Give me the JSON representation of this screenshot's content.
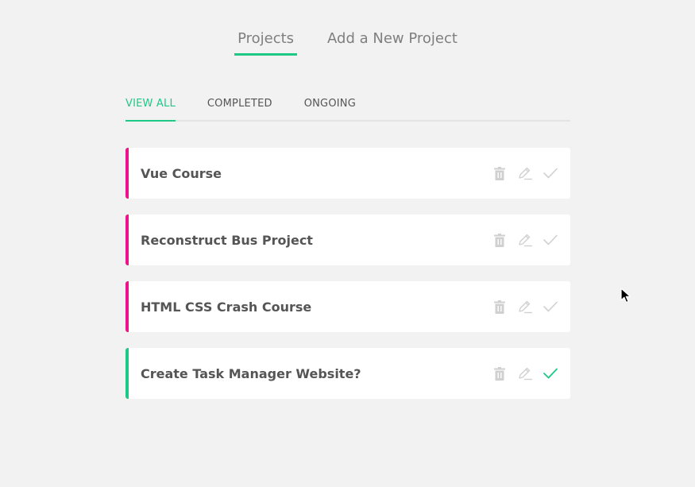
{
  "nav": {
    "projects_label": "Projects",
    "add_label": "Add a New Project"
  },
  "filters": {
    "view_all": "VIEW ALL",
    "completed": "COMPLETED",
    "ongoing": "ONGOING"
  },
  "projects": [
    {
      "title": "Vue Course",
      "complete": false
    },
    {
      "title": "Reconstruct Bus Project",
      "complete": false
    },
    {
      "title": "HTML CSS Crash Course",
      "complete": false
    },
    {
      "title": "Create Task Manager Website?",
      "complete": true
    }
  ],
  "icons": [
    "trash-icon",
    "pencil-icon",
    "check-icon"
  ],
  "colors": {
    "accent_green": "#1ec986",
    "ongoing_pink": "#f0128a",
    "icon_gray": "#d0d0d0",
    "background": "#f2f2f2"
  }
}
